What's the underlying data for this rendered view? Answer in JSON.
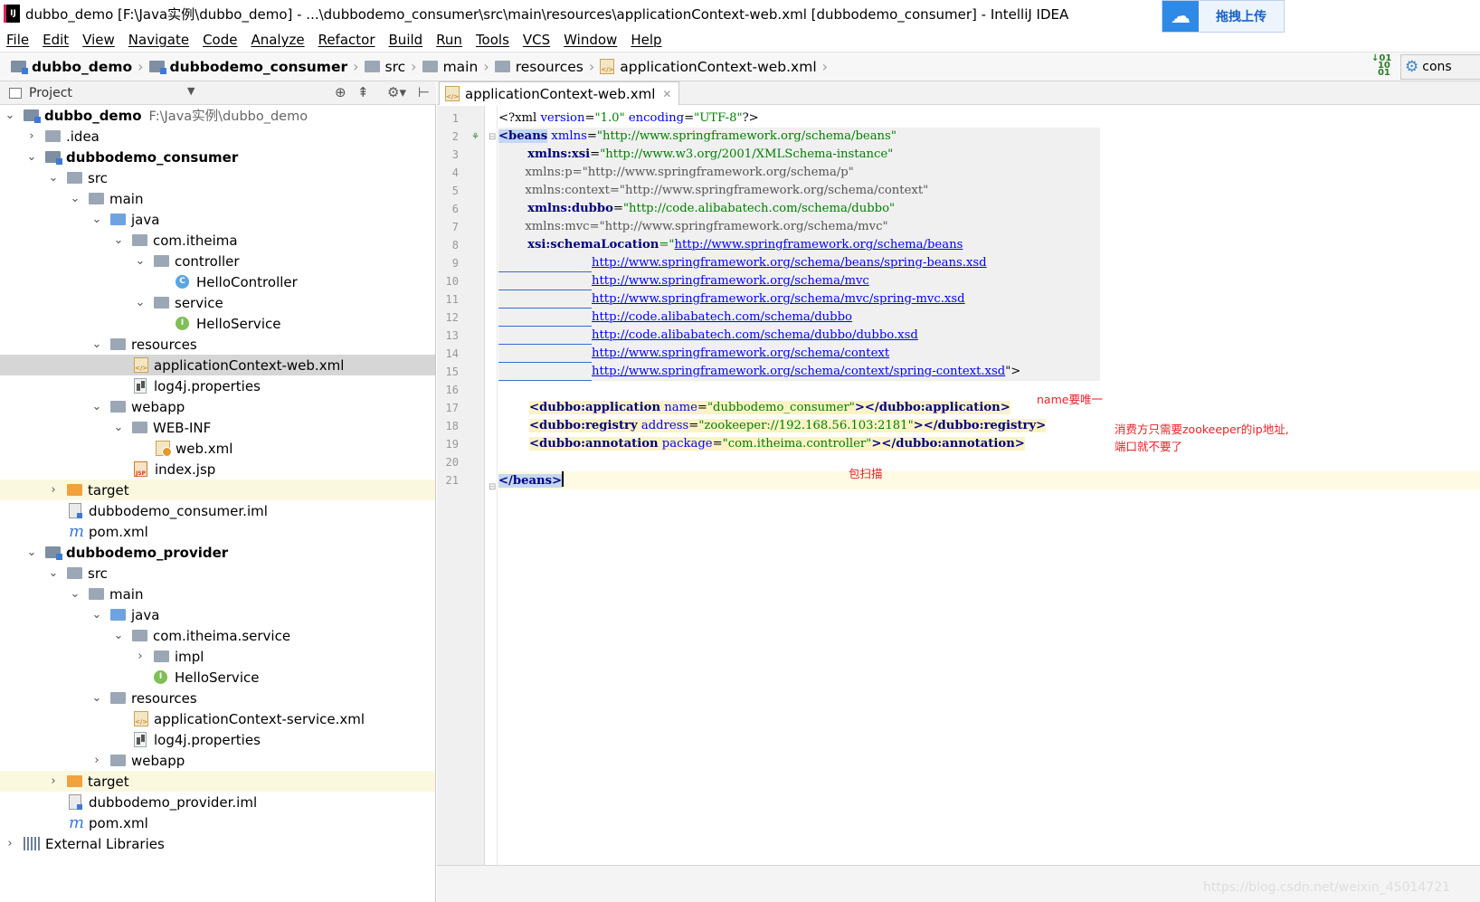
{
  "titlebar": {
    "title": "dubbo_demo [F:\\Java实例\\dubbo_demo] - ...\\dubbodemo_consumer\\src\\main\\resources\\applicationContext-web.xml [dubbodemo_consumer] - IntelliJ IDEA",
    "upload_label": "拖拽上传"
  },
  "menu": [
    "File",
    "Edit",
    "View",
    "Navigate",
    "Code",
    "Analyze",
    "Refactor",
    "Build",
    "Run",
    "Tools",
    "VCS",
    "Window",
    "Help"
  ],
  "breadcrumbs": [
    "dubbo_demo",
    "dubbodemo_consumer",
    "src",
    "main",
    "resources",
    "applicationContext-web.xml"
  ],
  "run_config": "cons",
  "project_panel": {
    "title": "Project",
    "tree": [
      {
        "label": "dubbo_demo",
        "sub": "F:\\Java实例\\dubbo_demo"
      },
      {
        "label": ".idea"
      },
      {
        "label": "dubbodemo_consumer"
      },
      {
        "label": "src"
      },
      {
        "label": "main"
      },
      {
        "label": "java"
      },
      {
        "label": "com.itheima"
      },
      {
        "label": "controller"
      },
      {
        "label": "HelloController"
      },
      {
        "label": "service"
      },
      {
        "label": "HelloService"
      },
      {
        "label": "resources"
      },
      {
        "label": "applicationContext-web.xml"
      },
      {
        "label": "log4j.properties"
      },
      {
        "label": "webapp"
      },
      {
        "label": "WEB-INF"
      },
      {
        "label": "web.xml"
      },
      {
        "label": "index.jsp"
      },
      {
        "label": "target"
      },
      {
        "label": "dubbodemo_consumer.iml"
      },
      {
        "label": "pom.xml"
      },
      {
        "label": "dubbodemo_provider"
      },
      {
        "label": "src"
      },
      {
        "label": "main"
      },
      {
        "label": "java"
      },
      {
        "label": "com.itheima.service"
      },
      {
        "label": "impl"
      },
      {
        "label": "HelloService"
      },
      {
        "label": "resources"
      },
      {
        "label": "applicationContext-service.xml"
      },
      {
        "label": "log4j.properties"
      },
      {
        "label": "webapp"
      },
      {
        "label": "target"
      },
      {
        "label": "dubbodemo_provider.iml"
      },
      {
        "label": "pom.xml"
      },
      {
        "label": "External Libraries"
      }
    ]
  },
  "editor": {
    "tab_label": "applicationContext-web.xml",
    "line_numbers": [
      "1",
      "2",
      "3",
      "4",
      "5",
      "6",
      "7",
      "8",
      "9",
      "10",
      "11",
      "12",
      "13",
      "14",
      "15",
      "16",
      "17",
      "18",
      "19",
      "20",
      "21"
    ],
    "code": {
      "l1": {
        "a": "<?xml ",
        "b": "version",
        "c": "=",
        "d": "\"1.0\"",
        "e": " ",
        "f": "encoding",
        "g": "=",
        "h": "\"UTF-8\"",
        "i": "?>"
      },
      "l2": {
        "a": "<beans",
        "b": " xmlns",
        "c": "=",
        "d": "\"http://www.springframework.org/schema/beans\""
      },
      "l3": {
        "a": "       xmlns:xsi",
        "b": "=",
        "c": "\"http://www.w3.org/2001/XMLSchema-instance\""
      },
      "l4": {
        "a": "       xmlns:p=\"http://www.springframework.org/schema/p\""
      },
      "l5": {
        "a": "       xmlns:context=\"http://www.springframework.org/schema/context\""
      },
      "l6": {
        "a": "       xmlns:dubbo",
        "b": "=",
        "c": "\"http://code.alibabatech.com/schema/dubbo\""
      },
      "l7": {
        "a": "       xmlns:mvc=\"http://www.springframework.org/schema/mvc\""
      },
      "l8": {
        "a": "       xsi:schemaLocation",
        "b": "=\"",
        "c": "http://www.springframework.org/schema/beans"
      },
      "l9": "http://www.springframework.org/schema/beans/spring-beans.xsd",
      "l10": "http://www.springframework.org/schema/mvc",
      "l11": "http://www.springframework.org/schema/mvc/spring-mvc.xsd",
      "l12": "http://code.alibabatech.com/schema/dubbo",
      "l13": "http://code.alibabatech.com/schema/dubbo/dubbo.xsd",
      "l14": "http://www.springframework.org/schema/context",
      "l15": {
        "url": "http://www.springframework.org/schema/context/spring-context.xsd",
        "end": "\">"
      },
      "l17": {
        "a": "<dubbo:application",
        "b": " name",
        "c": "=",
        "d": "\"dubbodemo_consumer\"",
        "e": "></dubbo:application>"
      },
      "l18": {
        "a": "<dubbo:registry",
        "b": " address",
        "c": "=",
        "d": "\"zookeeper://192.168.56.103:2181\"",
        "e": "></dubbo:registry>"
      },
      "l19": {
        "a": "<dubbo:annotation",
        "b": " package",
        "c": "=",
        "d": "\"com.itheima.controller\"",
        "e": "></dubbo:annotation>"
      },
      "l21": "</beans>"
    },
    "annotations": {
      "name_unique": "name要唯一",
      "registry_note_1": "消费方只需要zookeeper的ip地址,",
      "registry_note_2": "端口就不要了",
      "package_scan": "包扫描"
    }
  },
  "watermark": "https://blog.csdn.net/weixin_45014721",
  "colors": {
    "tag": "#000080",
    "attr_name": "#0000ff",
    "attr_value": "#008000",
    "annotation": "#e8232a",
    "selection": "#d6d6d6"
  }
}
